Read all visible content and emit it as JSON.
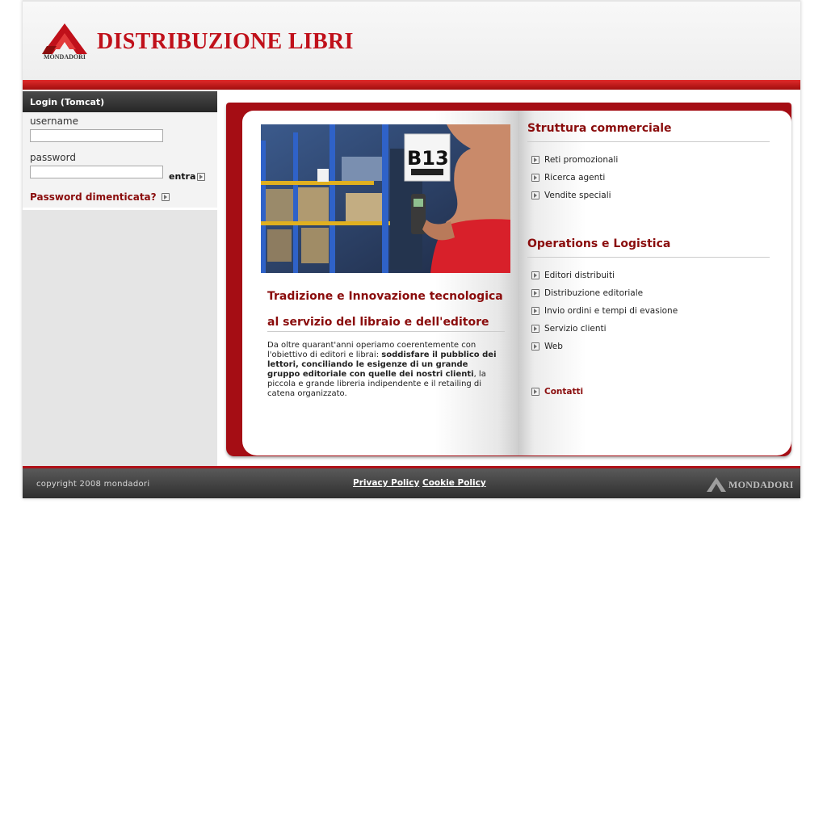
{
  "header": {
    "logo_text": "MONDADORI",
    "title": "DISTRIBUZIONE LIBRI"
  },
  "login": {
    "heading": "Login (Tomcat)",
    "username_label": "username",
    "username_value": "",
    "password_label": "password",
    "password_value": "",
    "submit_label": "entra",
    "forgot_label": "Password dimenticata?"
  },
  "left_page": {
    "photo_sign": "B13",
    "title_line1": "Tradizione e Innovazione tecnologica",
    "title_line2": "al servizio del libraio e dell'editore",
    "text_intro": "Da oltre quarant'anni operiamo coerentemente con l'obiettivo di editori e librai: ",
    "text_bold": "soddisfare il pubblico dei lettori, conciliando le esigenze di un grande gruppo editoriale con quelle dei nostri clienti",
    "text_end": ", la piccola e grande libreria indipendente e il retailing di catena organizzato."
  },
  "right_page": {
    "section1_title": "Struttura commerciale",
    "section1_links": [
      "Reti promozionali",
      "Ricerca agenti",
      "Vendite speciali"
    ],
    "section2_title": "Operations e Logistica",
    "section2_links": [
      "Editori distribuiti",
      "Distribuzione editoriale",
      "Invio ordini e tempi di evasione",
      "Servizio clienti",
      "Web"
    ],
    "contact_label": "Contatti"
  },
  "footer": {
    "copyright": "copyright 2008 mondadori",
    "privacy_label": "Privacy Policy",
    "cookie_label": "Cookie Policy",
    "logo_text": "MONDADORI"
  },
  "colors": {
    "brand_red": "#c0101a",
    "dark_red": "#8a0c0c",
    "footer_dark": "#2e2e2e"
  }
}
